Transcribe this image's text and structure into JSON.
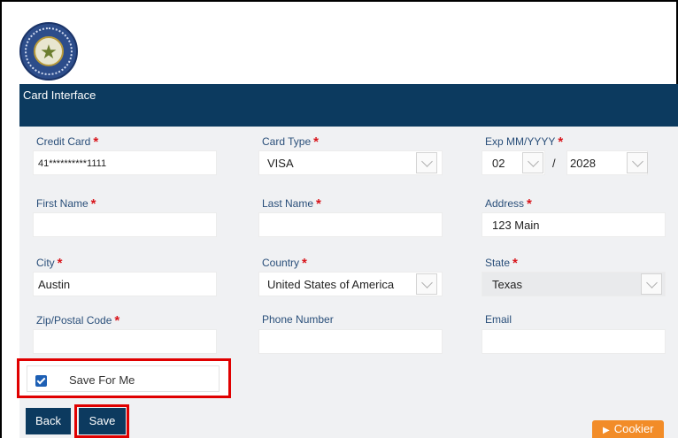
{
  "banner": {
    "title": "Card Interface"
  },
  "required_mark": "*",
  "fields": {
    "credit_card": {
      "label": "Credit Card",
      "value": "41**********1111"
    },
    "card_type": {
      "label": "Card Type",
      "value": "VISA"
    },
    "exp": {
      "label": "Exp MM/YYYY",
      "month": "02",
      "separator": "/",
      "year": "2028"
    },
    "first_name": {
      "label": "First Name",
      "value": ""
    },
    "last_name": {
      "label": "Last Name",
      "value": ""
    },
    "address": {
      "label": "Address",
      "value": "123 Main"
    },
    "city": {
      "label": "City",
      "value": "Austin"
    },
    "country": {
      "label": "Country",
      "value": "United States of America"
    },
    "state": {
      "label": "State",
      "value": "Texas"
    },
    "zip": {
      "label": "Zip/Postal Code",
      "value": ""
    },
    "phone": {
      "label": "Phone Number",
      "value": ""
    },
    "email": {
      "label": "Email",
      "value": ""
    }
  },
  "save_for_me": {
    "label": "Save For Me",
    "checked": true
  },
  "buttons": {
    "back": "Back",
    "save": "Save",
    "cookie": "Cookier"
  },
  "colors": {
    "banner": "#0c3a5f",
    "required": "#d8151b",
    "highlight": "#e00000",
    "cookie": "#f28c28"
  },
  "icons": {
    "seal": "state-seal-icon",
    "dropdown": "chevron-down-icon",
    "checkbox": "checkmark-icon"
  }
}
